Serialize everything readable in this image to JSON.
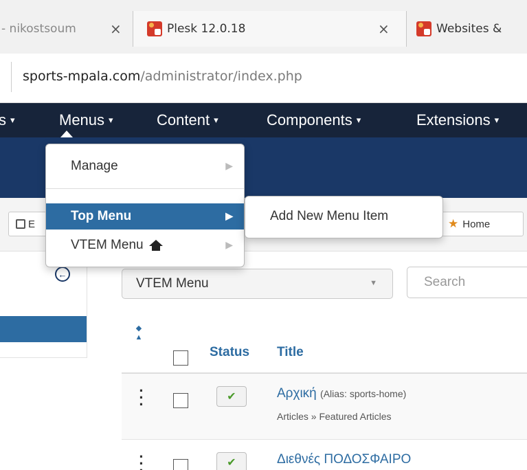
{
  "browser": {
    "tabs": [
      {
        "label": "- nikostsoum"
      },
      {
        "label": "Plesk 12.0.18"
      },
      {
        "label": "Websites &"
      }
    ],
    "close_glyph": "×",
    "url_domain": "sports-mpala.com",
    "url_path": "/administrator/index.php"
  },
  "navbar": {
    "items": [
      {
        "label": "s"
      },
      {
        "label": "Menus"
      },
      {
        "label": "Content"
      },
      {
        "label": "Components"
      },
      {
        "label": "Extensions"
      }
    ],
    "caret": "▾"
  },
  "menus_dropdown": {
    "items": [
      {
        "label": "Manage"
      },
      {
        "label": "Top Menu"
      },
      {
        "label": "VTEM Menu"
      }
    ],
    "submenu": {
      "label": "Add New Menu Item"
    }
  },
  "toolbar": {
    "edit_label": "E",
    "home_label": "Home"
  },
  "filters": {
    "menu_select_value": "VTEM Menu",
    "search_placeholder": "Search"
  },
  "table": {
    "headers": {
      "status": "Status",
      "title": "Title"
    },
    "rows": [
      {
        "title": "Αρχική",
        "alias": "(Alias: sports-home)",
        "meta": "Articles » Featured Articles",
        "status": "✔"
      },
      {
        "title": "Διεθνές ΠΟΔΟΣΦΑΙΡΟ",
        "status": "✔"
      }
    ]
  },
  "colors": {
    "navbar": "#17243a",
    "subheader": "#1a3867",
    "highlight": "#2d6ca2",
    "published_check": "#4a9a2a"
  }
}
